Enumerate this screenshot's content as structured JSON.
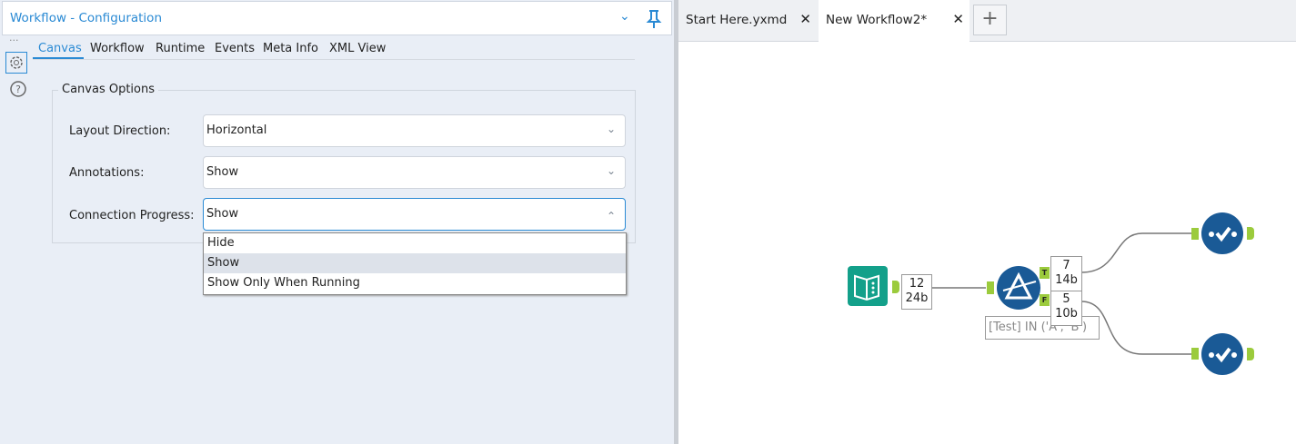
{
  "panel": {
    "title": "Workflow - Configuration",
    "tabs": [
      "Canvas",
      "Workflow",
      "Runtime",
      "Events",
      "Meta Info",
      "XML View"
    ],
    "active_tab": "Canvas"
  },
  "canvas_options": {
    "title": "Canvas Options",
    "layout_direction": {
      "label": "Layout Direction:",
      "value": "Horizontal"
    },
    "annotations": {
      "label": "Annotations:",
      "value": "Show"
    },
    "connection_progress": {
      "label": "Connection Progress:",
      "value": "Show",
      "options": [
        "Hide",
        "Show",
        "Show Only When Running"
      ],
      "highlighted": "Show"
    }
  },
  "doc_tabs": [
    {
      "label": "Start Here.yxmd"
    },
    {
      "label": "New Workflow2*",
      "active": true
    }
  ],
  "workflow": {
    "input_count": {
      "records": "12",
      "size": "24b"
    },
    "true_count": {
      "records": "7",
      "size": "14b"
    },
    "false_count": {
      "records": "5",
      "size": "10b"
    },
    "true_anchor": "T",
    "false_anchor": "F",
    "filter_annotation": "[Test] IN ('A', 'B')"
  },
  "colors": {
    "accent": "#2a8ad4",
    "tool_blue": "#1a5a96",
    "input_teal": "#13a08a",
    "anchor_green": "#9bcb3c"
  }
}
